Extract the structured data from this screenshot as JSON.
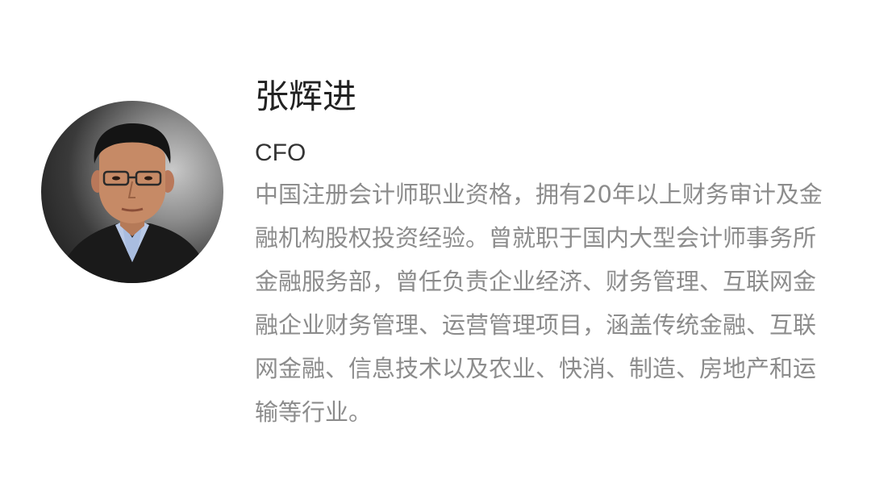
{
  "profile": {
    "name": "张辉进",
    "title": "CFO",
    "bio": "中国注册会计师职业资格，拥有20年以上财务审计及金融机构股权投资经验。曾就职于国内大型会计师事务所金融服务部，曾任负责企业经济、财务管理、互联网金融企业财务管理、运营管理项目，涵盖传统金融、互联网金融、信息技术以及农业、快消、制造、房地产和运输等行业。"
  },
  "colors": {
    "name": "#222222",
    "title": "#333333",
    "bio": "#8c8c8c",
    "background": "#ffffff"
  }
}
